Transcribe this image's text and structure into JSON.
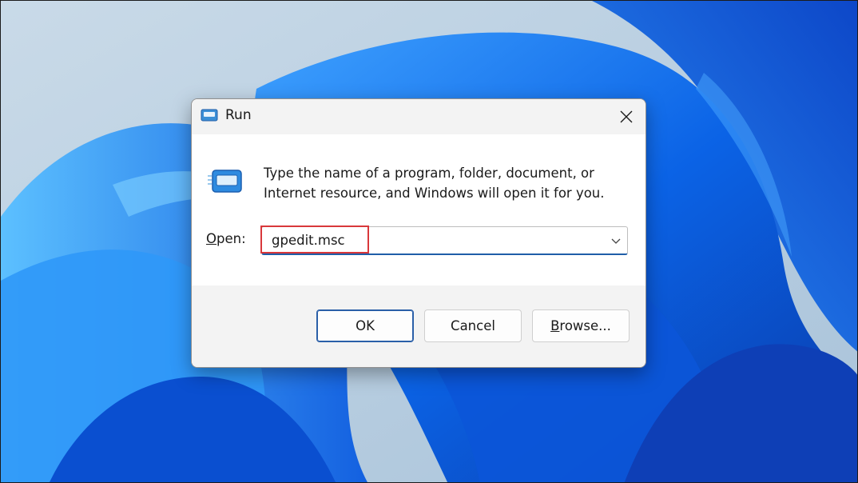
{
  "dialog": {
    "title": "Run",
    "description": "Type the name of a program, folder, document, or Internet resource, and Windows will open it for you.",
    "open_label_accel": "O",
    "open_label_rest": "pen:",
    "open_value": "gpedit.msc"
  },
  "buttons": {
    "ok": "OK",
    "cancel": "Cancel",
    "browse_accel": "B",
    "browse_rest": "rowse..."
  },
  "colors": {
    "highlight": "#d9383b",
    "accent": "#1f5ea8",
    "wallpaper_blue": "#0a5ce0"
  },
  "icons": {
    "app": "run-icon",
    "close": "close-icon",
    "dropdown": "chevron-down-icon"
  }
}
